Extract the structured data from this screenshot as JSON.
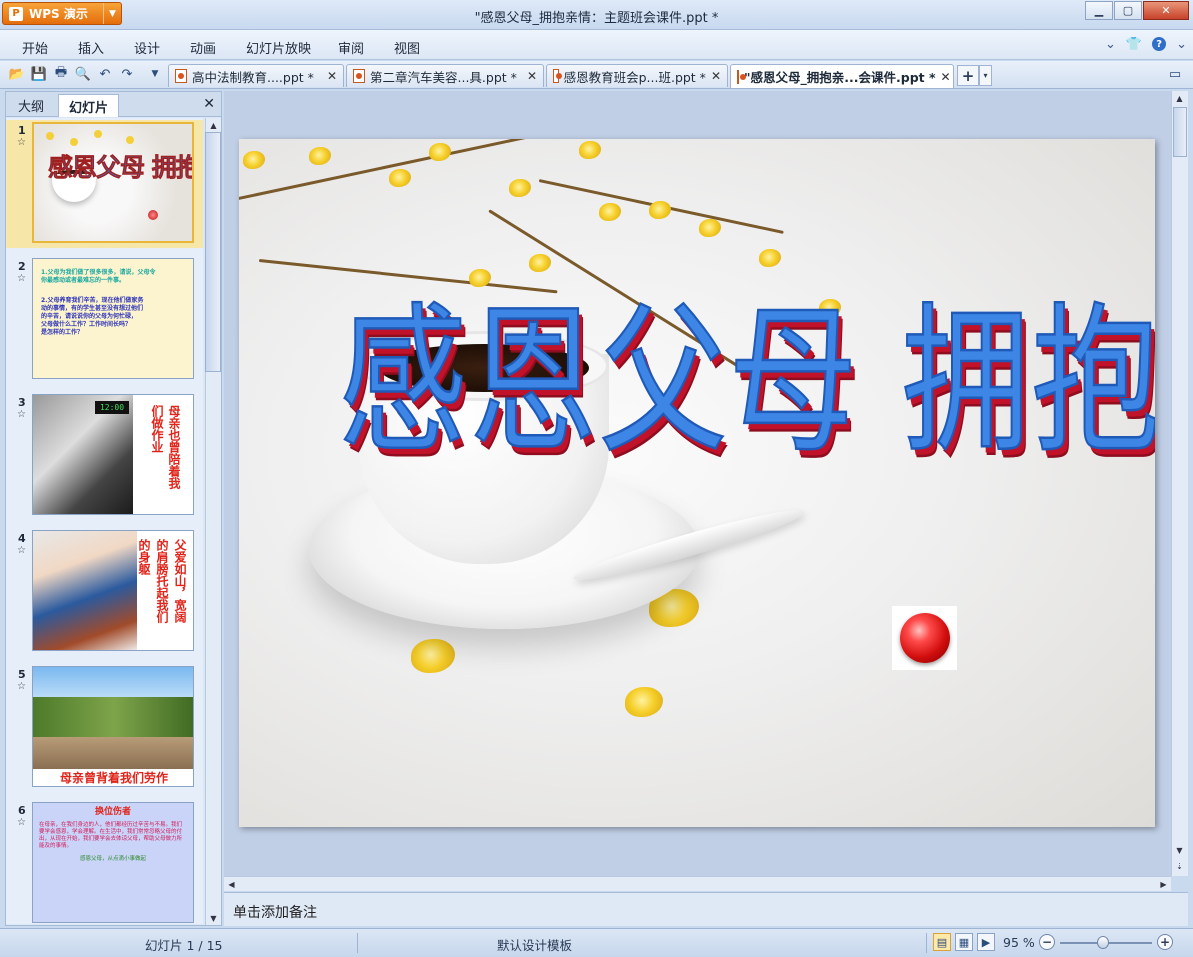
{
  "app": {
    "name": "WPS 演示",
    "window_title": "\"感恩父母_拥抱亲情：主题班会课件.ppt *"
  },
  "menu": {
    "items": [
      "开始",
      "插入",
      "设计",
      "动画",
      "幻灯片放映",
      "审阅",
      "视图"
    ]
  },
  "tabs": [
    {
      "label": "高中法制教育....ppt *"
    },
    {
      "label": "第二章汽车美容...具.ppt *"
    },
    {
      "label": "感恩教育班会p...班.ppt *"
    },
    {
      "label": "\"感恩父母_拥抱亲...会课件.ppt *"
    }
  ],
  "panel": {
    "tabs": [
      "大纲",
      "幻灯片"
    ]
  },
  "slides": [
    {
      "num": "1",
      "title": "感恩父母   拥抱亲情"
    },
    {
      "num": "2",
      "lines": [
        "1.父母为我们做了很多很多，请说，父母令",
        "你最感动或者最难忘的一件事。",
        "2.父母养育我们辛苦，现在他们做家务",
        "动的事情，有的学生甚至没有想过他们",
        "的辛苦，请说说你的父母为何忙碌，",
        "父母做什么工作？工作时间长吗？",
        "是怎样的工作？"
      ]
    },
    {
      "num": "3",
      "clock": "12:00",
      "text_a": "母亲也曾陪着我",
      "text_b": "们做作业"
    },
    {
      "num": "4",
      "text_a": "父爱如山，宽阔",
      "text_b": "的肩膀托起我们",
      "text_c": "的身躯"
    },
    {
      "num": "5",
      "caption": "母亲曾背着我们劳作"
    },
    {
      "num": "6",
      "heading": "换位伤者",
      "body": "在母亲，在我们身边的人，他们都经历过辛苦与不易。我们要学会感恩，学会理解。在生活中，我们常常忽略父母的付出，从现在开始，我们要学会去体谅父母，帮助父母做力所能及的事情。",
      "footer": "感恩父母，从点滴小事做起"
    }
  ],
  "main_slide": {
    "title": "感恩父母   拥抱亲情"
  },
  "notes": {
    "placeholder": "单击添加备注"
  },
  "status": {
    "slide_counter": "幻灯片 1 / 15",
    "template": "默认设计模板",
    "zoom": "95 %"
  }
}
